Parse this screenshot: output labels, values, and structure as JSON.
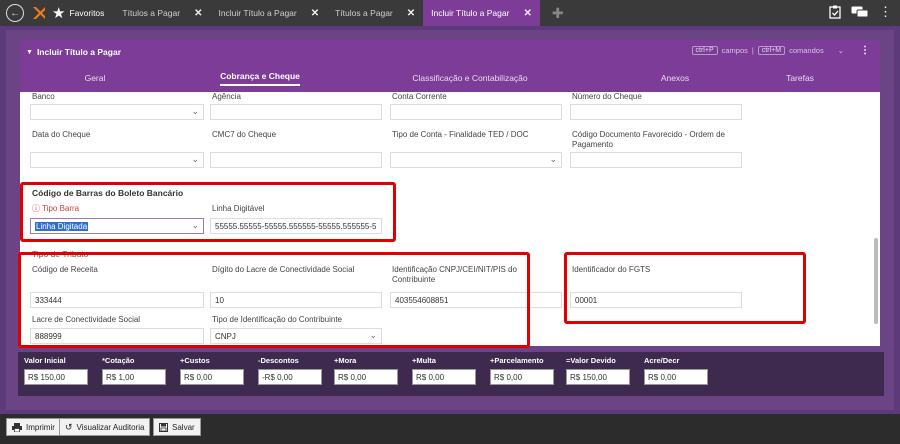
{
  "topbar": {
    "favorites_label": "Favoritos",
    "tabs": [
      {
        "label": "Títulos a Pagar"
      },
      {
        "label": "Incluir Título a Pagar"
      },
      {
        "label": "Títulos a Pagar"
      },
      {
        "label": "Incluir Título a Pagar"
      }
    ]
  },
  "panel": {
    "title": "Incluir Título a Pagar",
    "shortcut_fields_key": "ctrl+P",
    "shortcut_fields_label": "campos",
    "shortcut_separator": "|",
    "shortcut_commands_key": "ctrl+M",
    "shortcut_commands_label": "comandos"
  },
  "subtabs": [
    {
      "label": "Geral"
    },
    {
      "label": "Cobrança e Cheque"
    },
    {
      "label": "Classificação e Contabilização"
    },
    {
      "label": "Anexos"
    },
    {
      "label": "Tarefas"
    }
  ],
  "form": {
    "banco_label": "Banco",
    "agencia_label": "Agência",
    "conta_label": "Conta Corrente",
    "numero_cheque_label": "Número do Cheque",
    "data_cheque_label": "Data do Cheque",
    "cmc7_label": "CMC7 do Cheque",
    "tipo_conta_label": "Tipo de Conta - Finalidade TED / DOC",
    "codigo_doc_label": "Código Documento Favorecido - Ordem de Pagamento",
    "barcode_section": "Código de Barras do Boleto Bancário",
    "tipo_barra_label": "Tipo Barra",
    "tipo_barra_value": "Linha Digitada",
    "linha_digitavel_label": "Linha Digitável",
    "linha_digitavel_value": "55555.55555-55555.555555-55555.555555-5",
    "tributo_section": "Tipo de Tributo",
    "codigo_receita_label": "Código de Receita",
    "codigo_receita_value": "333444",
    "digito_lacre_label": "Dígito do Lacre de Conectividade Social",
    "digito_lacre_value": "10",
    "identificacao_label": "Identificação CNPJ/CEI/NIT/PIS do Contribuinte",
    "identificacao_value": "403554608851",
    "fgts_label": "Identificador do FGTS",
    "fgts_value": "00001",
    "lacre_label": "Lacre de Conectividade Social",
    "lacre_value": "888999",
    "tipo_ident_label": "Tipo de Identificação do Contribuinte",
    "tipo_ident_value": "CNPJ"
  },
  "totals": [
    {
      "label": "Valor Inicial",
      "value": "R$ 150,00"
    },
    {
      "label": "*Cotação",
      "value": "R$ 1,00"
    },
    {
      "label": "+Custos",
      "value": "R$ 0,00"
    },
    {
      "label": "-Descontos",
      "value": "-R$ 0,00"
    },
    {
      "label": "+Mora",
      "value": "R$ 0,00"
    },
    {
      "label": "+Multa",
      "value": "R$ 0,00"
    },
    {
      "label": "+Parcelamento",
      "value": "R$ 0,00"
    },
    {
      "label": "=Valor Devido",
      "value": "R$ 150,00"
    },
    {
      "label": "Acre/Decr",
      "value": "R$ 0,00"
    }
  ],
  "buttons": {
    "imprimir": "Imprimir",
    "auditoria": "Visualizar Auditoria",
    "salvar": "Salvar"
  },
  "colors": {
    "purple": "#7d3c98",
    "highlight_red": "#e00000"
  }
}
